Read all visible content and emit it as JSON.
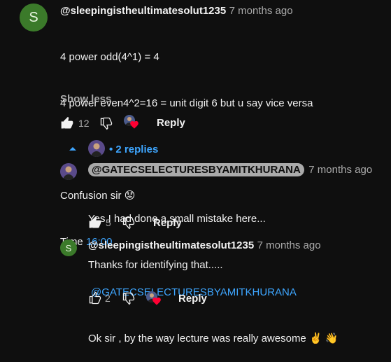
{
  "comment": {
    "avatar_letter": "S",
    "author": "@sleepingistheultimatesolut1235",
    "time": "7 months ago",
    "lines": [
      "4 power odd(4^1) = 4",
      "4 power even4^2=16 = unit digit 6 but u say vice versa",
      "",
      "Confusion sir 😟"
    ],
    "time_prefix": "Time ",
    "timestamp_link": "16:00",
    "show_less": "Show less",
    "likes": "12",
    "reply_label": "Reply"
  },
  "replies_toggle": {
    "label": "• 2 replies"
  },
  "reply1": {
    "mention": "@GATECSELECTURESBYAMITKHURANA",
    "time": "7 months ago",
    "lines": [
      "Yes I had done a small mistake here...",
      "Thanks for identifying that....."
    ],
    "likes": "5",
    "reply_label": "Reply"
  },
  "reply2": {
    "avatar_letter": "S",
    "author": "@sleepingistheultimatesolut1235",
    "time": "7 months ago",
    "mention_link": "@GATECSELECTURESBYAMITKHURANA",
    "text": "Ok sir , by the way lecture was really awesome ✌️ 👋",
    "likes": "2",
    "reply_label": "Reply"
  },
  "colors": {
    "background": "#0f0f0f",
    "link": "#3ea6ff",
    "avatar_green": "#3b7a2a",
    "heart": "#ff0033"
  }
}
